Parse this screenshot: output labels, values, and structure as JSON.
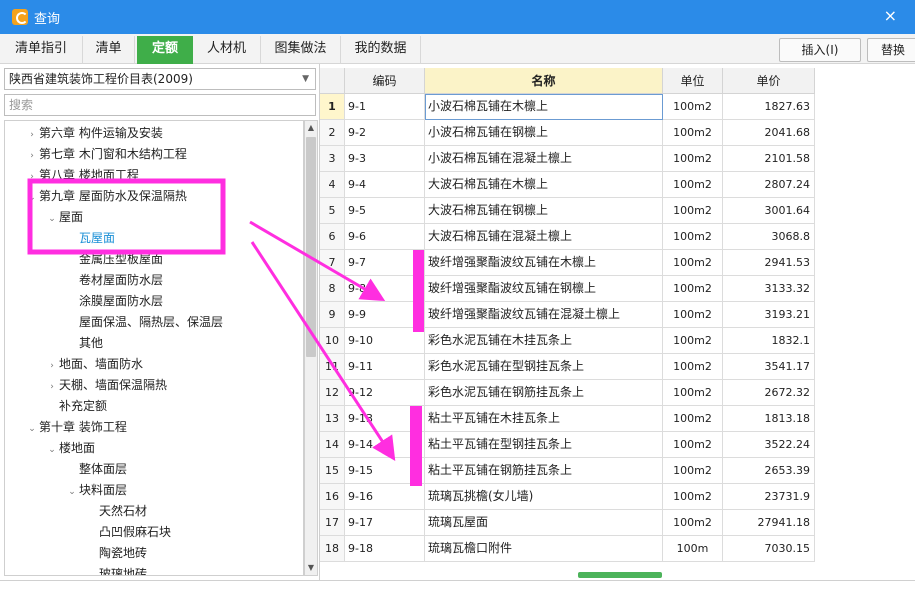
{
  "window": {
    "title": "查询"
  },
  "tabs": [
    {
      "label": "清单指引"
    },
    {
      "label": "清单"
    },
    {
      "label": "定额"
    },
    {
      "label": "人材机"
    },
    {
      "label": "图集做法"
    },
    {
      "label": "我的数据"
    }
  ],
  "toolbar": {
    "insert_label": "插入(I)",
    "replace_label": "替换"
  },
  "left": {
    "database": "陕西省建筑装饰工程价目表(2009)",
    "search_placeholder": "搜索",
    "tree": [
      {
        "label": "第六章 构件运输及安装",
        "toggle": "›"
      },
      {
        "label": "第七章 木门窗和木结构工程",
        "toggle": "›"
      },
      {
        "label": "第八章 楼地面工程",
        "toggle": "›"
      },
      {
        "label": "第九章 屋面防水及保温隔热",
        "toggle": "⌄"
      },
      {
        "label": "屋面",
        "toggle": "⌄"
      },
      {
        "label": "瓦屋面",
        "toggle": ""
      },
      {
        "label": "金属压型板屋面",
        "toggle": ""
      },
      {
        "label": "卷材屋面防水层",
        "toggle": ""
      },
      {
        "label": "涂膜屋面防水层",
        "toggle": ""
      },
      {
        "label": "屋面保温、隔热层、保温层",
        "toggle": ""
      },
      {
        "label": "其他",
        "toggle": ""
      },
      {
        "label": "地面、墙面防水",
        "toggle": "›"
      },
      {
        "label": "天棚、墙面保温隔热",
        "toggle": "›"
      },
      {
        "label": "补充定额",
        "toggle": ""
      },
      {
        "label": "第十章 装饰工程",
        "toggle": "⌄"
      },
      {
        "label": "楼地面",
        "toggle": "⌄"
      },
      {
        "label": "整体面层",
        "toggle": ""
      },
      {
        "label": "块料面层",
        "toggle": "⌄"
      },
      {
        "label": "天然石材",
        "toggle": ""
      },
      {
        "label": "凸凹假麻石块",
        "toggle": ""
      },
      {
        "label": "陶瓷地砖",
        "toggle": ""
      },
      {
        "label": "玻璃地砖",
        "toggle": ""
      }
    ]
  },
  "grid": {
    "headers": {
      "code": "编码",
      "name": "名称",
      "unit": "单位",
      "price": "单价"
    },
    "rows": [
      {
        "num": "1",
        "code": "9-1",
        "name": "小波石棉瓦铺在木檩上",
        "unit": "100m2",
        "price": "1827.63"
      },
      {
        "num": "2",
        "code": "9-2",
        "name": "小波石棉瓦铺在钢檩上",
        "unit": "100m2",
        "price": "2041.68"
      },
      {
        "num": "3",
        "code": "9-3",
        "name": "小波石棉瓦铺在混凝土檩上",
        "unit": "100m2",
        "price": "2101.58"
      },
      {
        "num": "4",
        "code": "9-4",
        "name": "大波石棉瓦铺在木檩上",
        "unit": "100m2",
        "price": "2807.24"
      },
      {
        "num": "5",
        "code": "9-5",
        "name": "大波石棉瓦铺在钢檩上",
        "unit": "100m2",
        "price": "3001.64"
      },
      {
        "num": "6",
        "code": "9-6",
        "name": "大波石棉瓦铺在混凝土檩上",
        "unit": "100m2",
        "price": "3068.8"
      },
      {
        "num": "7",
        "code": "9-7",
        "name": "玻纤增强聚酯波纹瓦铺在木檩上",
        "unit": "100m2",
        "price": "2941.53"
      },
      {
        "num": "8",
        "code": "9-8",
        "name": "玻纤增强聚酯波纹瓦铺在钢檩上",
        "unit": "100m2",
        "price": "3133.32"
      },
      {
        "num": "9",
        "code": "9-9",
        "name": "玻纤增强聚酯波纹瓦铺在混凝土檩上",
        "unit": "100m2",
        "price": "3193.21"
      },
      {
        "num": "10",
        "code": "9-10",
        "name": "彩色水泥瓦铺在木挂瓦条上",
        "unit": "100m2",
        "price": "1832.1"
      },
      {
        "num": "11",
        "code": "9-11",
        "name": "彩色水泥瓦铺在型钢挂瓦条上",
        "unit": "100m2",
        "price": "3541.17"
      },
      {
        "num": "12",
        "code": "9-12",
        "name": "彩色水泥瓦铺在钢筋挂瓦条上",
        "unit": "100m2",
        "price": "2672.32"
      },
      {
        "num": "13",
        "code": "9-13",
        "name": "粘土平瓦铺在木挂瓦条上",
        "unit": "100m2",
        "price": "1813.18"
      },
      {
        "num": "14",
        "code": "9-14",
        "name": "粘土平瓦铺在型钢挂瓦条上",
        "unit": "100m2",
        "price": "3522.24"
      },
      {
        "num": "15",
        "code": "9-15",
        "name": "粘土平瓦铺在钢筋挂瓦条上",
        "unit": "100m2",
        "price": "2653.39"
      },
      {
        "num": "16",
        "code": "9-16",
        "name": "琉璃瓦挑檐(女儿墙)",
        "unit": "100m2",
        "price": "23731.9"
      },
      {
        "num": "17",
        "code": "9-17",
        "name": "琉璃瓦屋面",
        "unit": "100m2",
        "price": "27941.18"
      },
      {
        "num": "18",
        "code": "9-18",
        "name": "琉璃瓦檐口附件",
        "unit": "100m",
        "price": "7030.15"
      }
    ]
  },
  "colors": {
    "titlebar": "#2b8be8",
    "active_tab": "#3fae49",
    "annotation": "#ff2ee0",
    "selected_tree": "#1a8fd6"
  }
}
